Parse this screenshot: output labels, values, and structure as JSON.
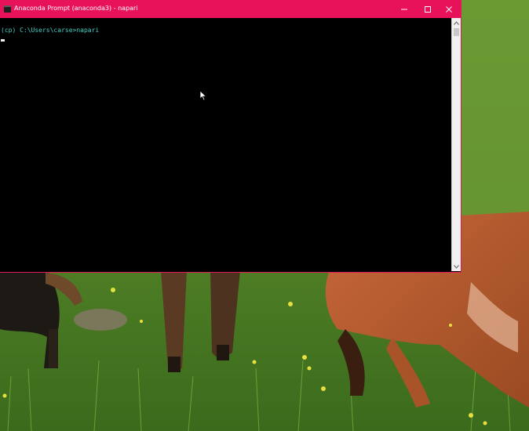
{
  "window": {
    "title": "Anaconda Prompt (anaconda3) - napari",
    "icon": "terminal-icon",
    "controls": {
      "minimize": "minimize-icon",
      "maximize": "maximize-icon",
      "close": "close-icon"
    }
  },
  "console": {
    "prompt_line": "(cp) C:\\Users\\carse>napari"
  },
  "colors": {
    "titlebar": "#e8125a",
    "console_bg": "#000000",
    "console_text": "#3fd2c6"
  }
}
